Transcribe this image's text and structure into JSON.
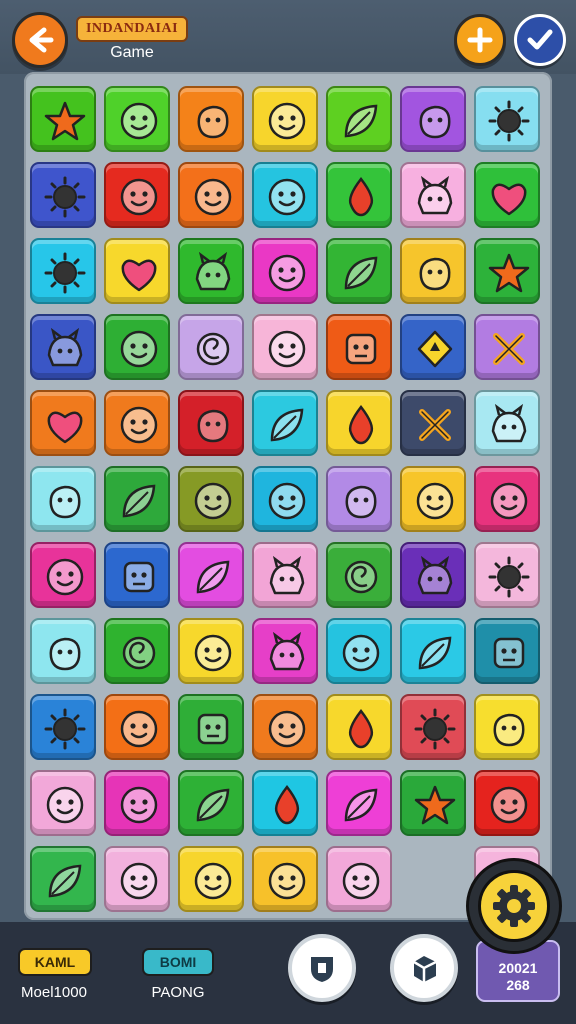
{
  "header": {
    "title": "INDANDAIAI",
    "subtitle": "Game",
    "back_icon": "back-arrow-icon",
    "plus_icon": "plus-icon",
    "check_icon": "checkmark-icon"
  },
  "board": {
    "columns": 7,
    "tiles": [
      {
        "color": "#44c21e",
        "icon": "star"
      },
      {
        "color": "#4fd12a",
        "icon": "face"
      },
      {
        "color": "#f48219",
        "icon": "blob"
      },
      {
        "color": "#f7d52c",
        "icon": "face"
      },
      {
        "color": "#5ed021",
        "icon": "leaf"
      },
      {
        "color": "#a255e0",
        "icon": "blob"
      },
      {
        "color": "#86def0",
        "icon": "sun"
      },
      {
        "color": "#3f55cc",
        "icon": "sun"
      },
      {
        "color": "#e52a1f",
        "icon": "face"
      },
      {
        "color": "#f3701a",
        "icon": "face"
      },
      {
        "color": "#25c4e0",
        "icon": "face"
      },
      {
        "color": "#34c43a",
        "icon": "drop"
      },
      {
        "color": "#f7b0e0",
        "icon": "creature"
      },
      {
        "color": "#2fc03a",
        "icon": "heart"
      },
      {
        "color": "#27c6e9",
        "icon": "sun"
      },
      {
        "color": "#f7d82c",
        "icon": "heart"
      },
      {
        "color": "#2fb92d",
        "icon": "creature"
      },
      {
        "color": "#ea38c5",
        "icon": "face"
      },
      {
        "color": "#33b534",
        "icon": "leaf"
      },
      {
        "color": "#f6c52c",
        "icon": "blob"
      },
      {
        "color": "#2db23a",
        "icon": "star"
      },
      {
        "color": "#3a56c6",
        "icon": "creature"
      },
      {
        "color": "#2eaf34",
        "icon": "face"
      },
      {
        "color": "#c6a5e8",
        "icon": "swirl"
      },
      {
        "color": "#f7b5d8",
        "icon": "face"
      },
      {
        "color": "#ef5b16",
        "icon": "box"
      },
      {
        "color": "#3564c8",
        "icon": "diamond"
      },
      {
        "color": "#b27ce2",
        "icon": "cross"
      },
      {
        "color": "#f07a1d",
        "icon": "heart"
      },
      {
        "color": "#f07a1d",
        "icon": "face"
      },
      {
        "color": "#d42029",
        "icon": "blob"
      },
      {
        "color": "#2cc9e0",
        "icon": "leaf"
      },
      {
        "color": "#f7d52c",
        "icon": "drop"
      },
      {
        "color": "#3d4a6a",
        "icon": "cross"
      },
      {
        "color": "#a8e8f2",
        "icon": "creature"
      },
      {
        "color": "#8ee6ef",
        "icon": "blob"
      },
      {
        "color": "#2ea93b",
        "icon": "leaf"
      },
      {
        "color": "#869a25",
        "icon": "face"
      },
      {
        "color": "#1fb5de",
        "icon": "face"
      },
      {
        "color": "#b28ae6",
        "icon": "blob"
      },
      {
        "color": "#f7c52a",
        "icon": "face"
      },
      {
        "color": "#e8337e",
        "icon": "face"
      },
      {
        "color": "#e8339a",
        "icon": "face"
      },
      {
        "color": "#2c68cf",
        "icon": "box"
      },
      {
        "color": "#e34de1",
        "icon": "leaf"
      },
      {
        "color": "#f2a5d6",
        "icon": "creature"
      },
      {
        "color": "#3aae3a",
        "icon": "swirl"
      },
      {
        "color": "#6a2fb8",
        "icon": "creature"
      },
      {
        "color": "#f4b7dc",
        "icon": "sun"
      },
      {
        "color": "#8ee6ef",
        "icon": "blob"
      },
      {
        "color": "#2fb32f",
        "icon": "swirl"
      },
      {
        "color": "#f7d82c",
        "icon": "face"
      },
      {
        "color": "#e63fc8",
        "icon": "creature"
      },
      {
        "color": "#25c3e0",
        "icon": "face"
      },
      {
        "color": "#2bc9e6",
        "icon": "leaf"
      },
      {
        "color": "#1f8fa9",
        "icon": "box"
      },
      {
        "color": "#2a83d8",
        "icon": "sun"
      },
      {
        "color": "#f36f16",
        "icon": "face"
      },
      {
        "color": "#2fae37",
        "icon": "box"
      },
      {
        "color": "#f07a1d",
        "icon": "face"
      },
      {
        "color": "#f7d82c",
        "icon": "drop"
      },
      {
        "color": "#e04b56",
        "icon": "sun"
      },
      {
        "color": "#f7de2e",
        "icon": "blob"
      },
      {
        "color": "#f2a8d9",
        "icon": "face"
      },
      {
        "color": "#e634b7",
        "icon": "face"
      },
      {
        "color": "#2eb136",
        "icon": "leaf"
      },
      {
        "color": "#1fc6e3",
        "icon": "drop"
      },
      {
        "color": "#ee3fd6",
        "icon": "leaf"
      },
      {
        "color": "#2aa93a",
        "icon": "star"
      },
      {
        "color": "#e5231e",
        "icon": "face"
      },
      {
        "color": "#33b64d",
        "icon": "leaf"
      },
      {
        "color": "#f2b1dd",
        "icon": "face"
      },
      {
        "color": "#f7d52c",
        "icon": "face"
      },
      {
        "color": "#f7c12a",
        "icon": "face"
      },
      {
        "color": "#f2a8d9",
        "icon": "face"
      },
      {
        "color": "",
        "icon": ""
      },
      {
        "color": "#f5b4dc",
        "icon": "face"
      }
    ]
  },
  "footer": {
    "mode_a_label": "KAML",
    "mode_a_value": "Moel1000",
    "mode_b_label": "BOMI",
    "mode_b_value": "PAONG",
    "tool_a_icon": "shield-icon",
    "tool_b_icon": "cube-icon",
    "score_line1": "20021",
    "score_line2": "268",
    "gear_icon": "gear-icon"
  }
}
